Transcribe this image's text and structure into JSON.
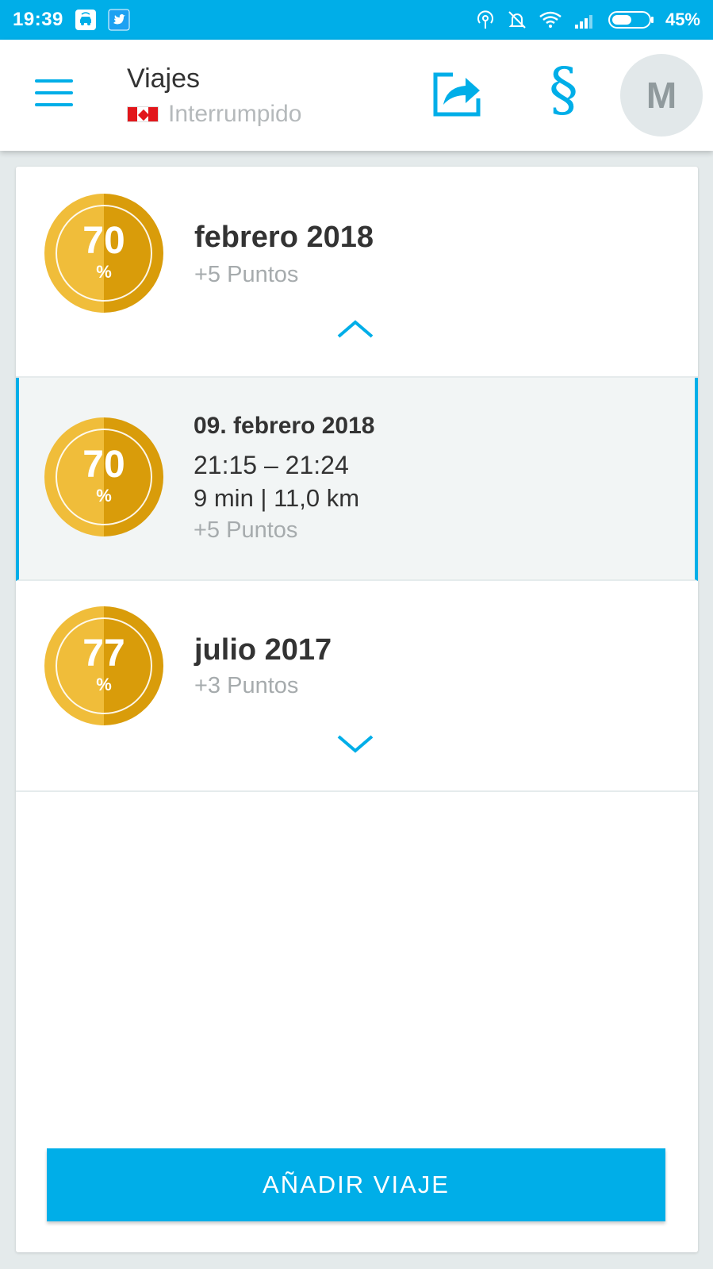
{
  "status_bar": {
    "time": "19:39",
    "battery_pct": "45%",
    "icons": [
      "car-wifi-icon",
      "twitter-icon",
      "hotspot-icon",
      "bell-off-icon",
      "wifi-icon",
      "signal-icon",
      "battery-icon"
    ]
  },
  "header": {
    "title": "Viajes",
    "status": "Interrumpido",
    "avatar_initial": "M",
    "para_symbol": "§"
  },
  "months": [
    {
      "score": "70",
      "percent_sign": "%",
      "label": "febrero 2018",
      "points": "+5 Puntos",
      "expanded": true
    },
    {
      "score": "77",
      "percent_sign": "%",
      "label": "julio 2017",
      "points": "+3 Puntos",
      "expanded": false
    }
  ],
  "trip": {
    "score": "70",
    "percent_sign": "%",
    "date": "09. febrero 2018",
    "time_range": "21:15 – 21:24",
    "duration_distance": "9 min | 11,0 km",
    "points": "+5 Puntos"
  },
  "actions": {
    "add_trip": "AÑADIR VIAJE"
  },
  "colors": {
    "accent": "#00aee8",
    "badge_gold_light": "#f0bd3a",
    "badge_gold_dark": "#d99c0a",
    "text_dark": "#333333",
    "text_muted": "#a6abad"
  }
}
